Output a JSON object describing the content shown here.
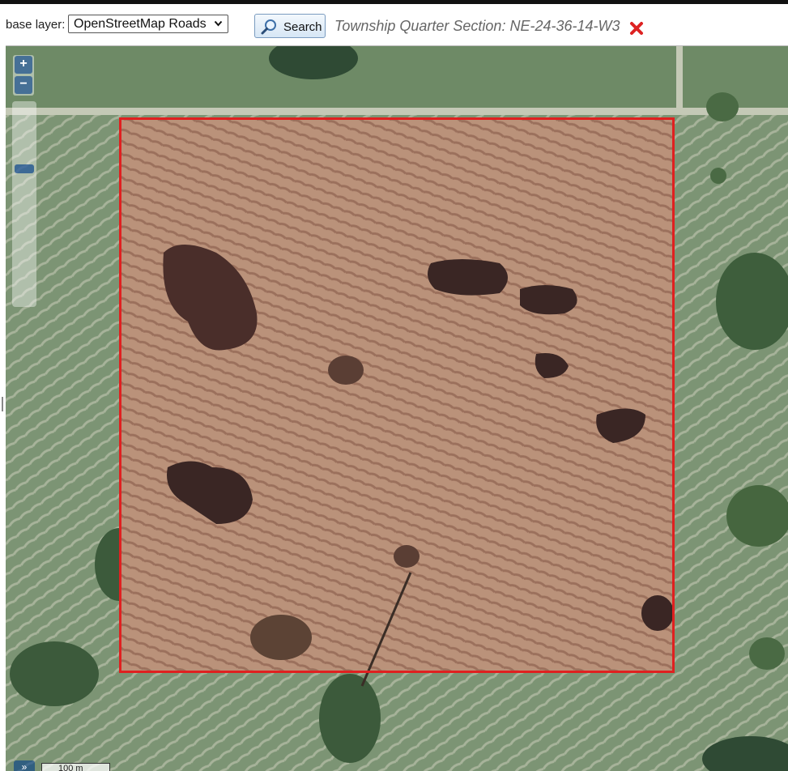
{
  "toolbar": {
    "base_layer_label": "base layer:",
    "base_layer_selected": "OpenStreetMap Roads",
    "search_label": "Search",
    "township_text": "Township Quarter Section: NE-24-36-14-W3"
  },
  "map": {
    "zoom_in_label": "+",
    "zoom_out_label": "−",
    "expand_label": "»",
    "scale_label": "100 m",
    "highlight_color": "#e02020"
  },
  "icons": {
    "search": "magnifier-icon",
    "close": "close-icon",
    "dropdown": "chevron-down-icon"
  }
}
